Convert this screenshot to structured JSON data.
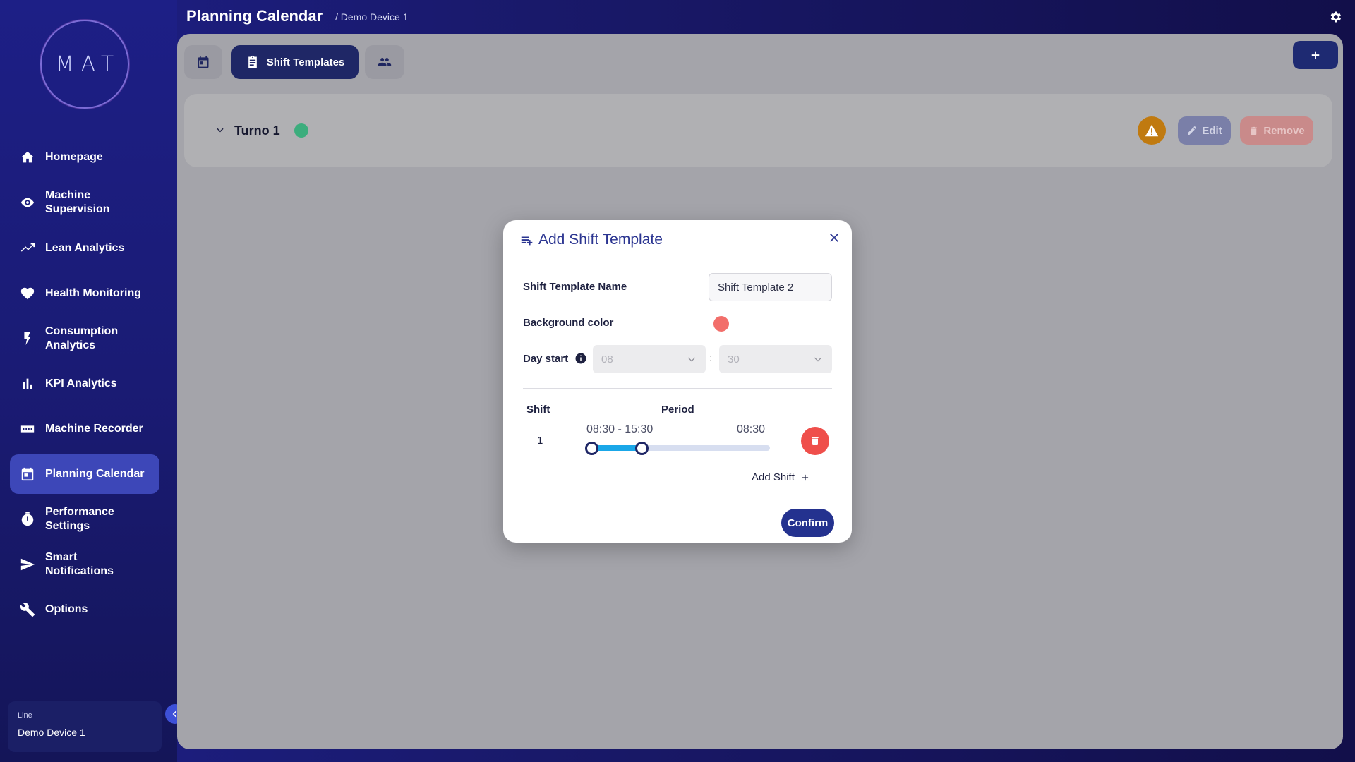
{
  "app": {
    "logo_text": "MAT",
    "page_title": "Planning Calendar",
    "breadcrumb": "/ Demo Device 1"
  },
  "sidebar": {
    "items": [
      {
        "label": "Homepage",
        "icon": "home-icon"
      },
      {
        "label": "Machine Supervision",
        "icon": "eye-icon"
      },
      {
        "label": "Lean Analytics",
        "icon": "trending-icon"
      },
      {
        "label": "Health Monitoring",
        "icon": "heart-pulse-icon"
      },
      {
        "label": "Consumption Analytics",
        "icon": "bolt-icon"
      },
      {
        "label": "KPI Analytics",
        "icon": "bar-chart-icon"
      },
      {
        "label": "Machine Recorder",
        "icon": "recorder-icon"
      },
      {
        "label": "Planning Calendar",
        "icon": "calendar-icon",
        "active": true
      },
      {
        "label": "Performance Settings",
        "icon": "timer-icon"
      },
      {
        "label": "Smart Notifications",
        "icon": "send-icon"
      },
      {
        "label": "Options",
        "icon": "wrench-icon"
      }
    ],
    "line_label": "Line",
    "line_value": "Demo Device 1"
  },
  "tabs": {
    "shift_templates_label": "Shift Templates"
  },
  "template_card": {
    "name": "Turno 1",
    "dot_color": "#3cad7d",
    "edit_label": "Edit",
    "remove_label": "Remove"
  },
  "modal": {
    "title": "Add Shift Template",
    "name_label": "Shift Template Name",
    "name_value": "Shift Template 2",
    "bg_color_label": "Background color",
    "bg_color": "#f26e6a",
    "day_start_label": "Day start",
    "day_start_hour": "08",
    "day_start_minute": "30",
    "col_shift": "Shift",
    "col_period": "Period",
    "shifts": [
      {
        "number": "1",
        "range": "08:30 - 15:30",
        "end": "08:30"
      }
    ],
    "add_shift_label": "Add Shift",
    "confirm_label": "Confirm"
  },
  "colors": {
    "accent": "#2b3591",
    "active_nav": "#3d47b8",
    "danger": "#ef4f4b",
    "warning": "#c07a10",
    "slider_fill": "#1aa7e8"
  }
}
